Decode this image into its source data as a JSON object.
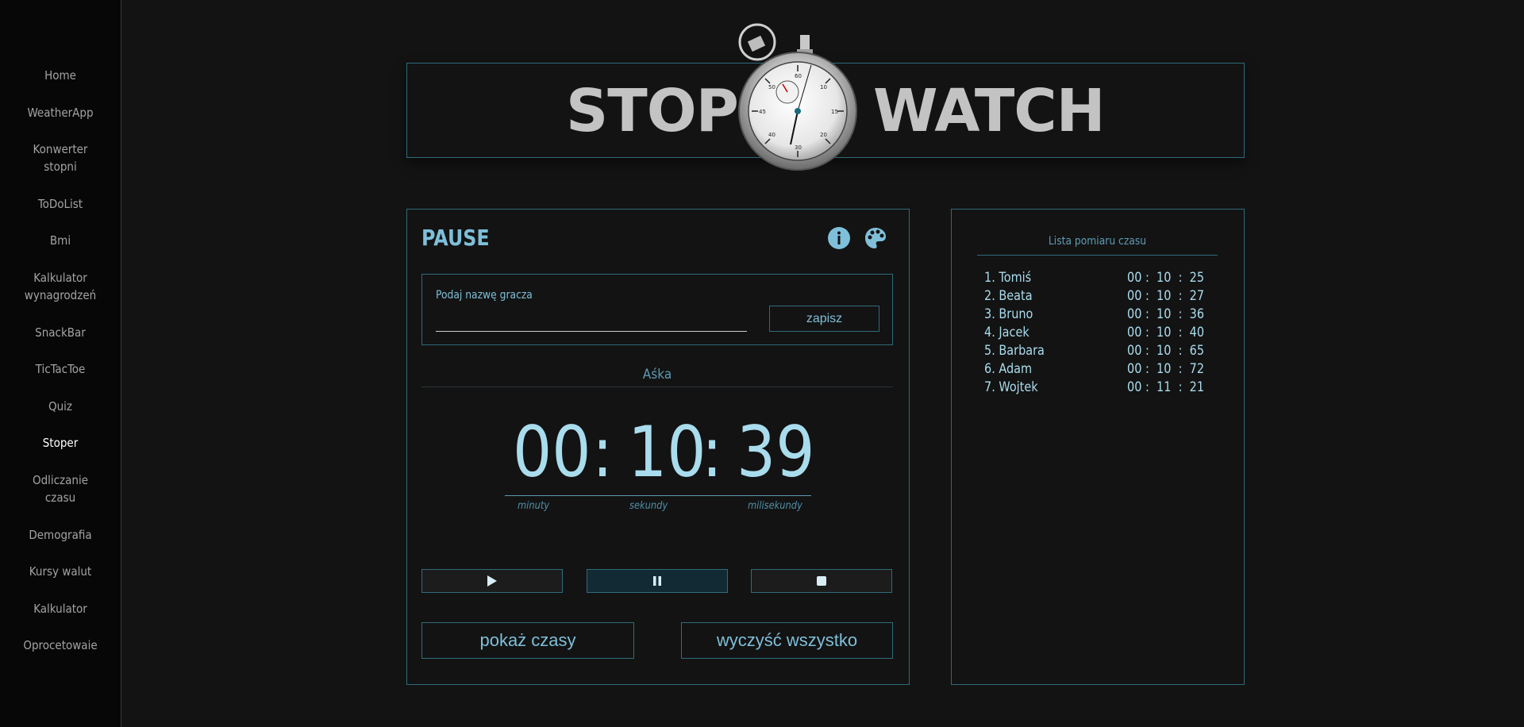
{
  "sidebar": {
    "items": [
      {
        "label": "Home"
      },
      {
        "label": "WeatherApp"
      },
      {
        "label": "Konwerter stopni"
      },
      {
        "label": "ToDoList"
      },
      {
        "label": "Bmi"
      },
      {
        "label": "Kalkulator wynagrodzeń"
      },
      {
        "label": "SnackBar"
      },
      {
        "label": "TicTacToe"
      },
      {
        "label": "Quiz"
      },
      {
        "label": "Stoper"
      },
      {
        "label": "Odliczanie czasu"
      },
      {
        "label": "Demografia"
      },
      {
        "label": "Kursy walut"
      },
      {
        "label": "Kalkulator"
      },
      {
        "label": "Oprocetowaie"
      }
    ],
    "active": "Stoper"
  },
  "header": {
    "word_left": "STOP",
    "word_right": "WATCH"
  },
  "panel": {
    "status": "PAUSE",
    "info_icon": "info-icon",
    "palette_icon": "palette-icon",
    "name_label": "Podaj nazwę gracza",
    "name_value": "",
    "save_label": "zapisz",
    "player_name": "Aśka",
    "timer": {
      "minutes": "00",
      "sep1": ":",
      "seconds": "10",
      "sep2": ":",
      "millis": "39"
    },
    "units": {
      "minutes": "minuty",
      "seconds": "sekundy",
      "millis": "milisekundy"
    },
    "controls": {
      "play": "play-icon",
      "pause": "pause-icon",
      "stop": "stop-icon"
    },
    "show_times_label": "pokaż czasy",
    "clear_all_label": "wyczyść wszystko"
  },
  "list": {
    "title": "Lista pomiaru czasu",
    "rows": [
      {
        "name": "1. Tomiś",
        "time": "00 :  10  :  25"
      },
      {
        "name": "2. Beata",
        "time": "00 :  10  :  27"
      },
      {
        "name": "3. Bruno",
        "time": "00 :  10  :  36"
      },
      {
        "name": "4. Jacek",
        "time": "00 :  10  :  40"
      },
      {
        "name": "5. Barbara",
        "time": "00 :  10  :  65"
      },
      {
        "name": "6. Adam",
        "time": "00 :  10  :  72"
      },
      {
        "name": "7. Wojtek",
        "time": "00 :  11  :  21"
      }
    ]
  },
  "colors": {
    "accent": "#7fbfd9",
    "border": "#2f6b7a",
    "background": "#131313"
  }
}
